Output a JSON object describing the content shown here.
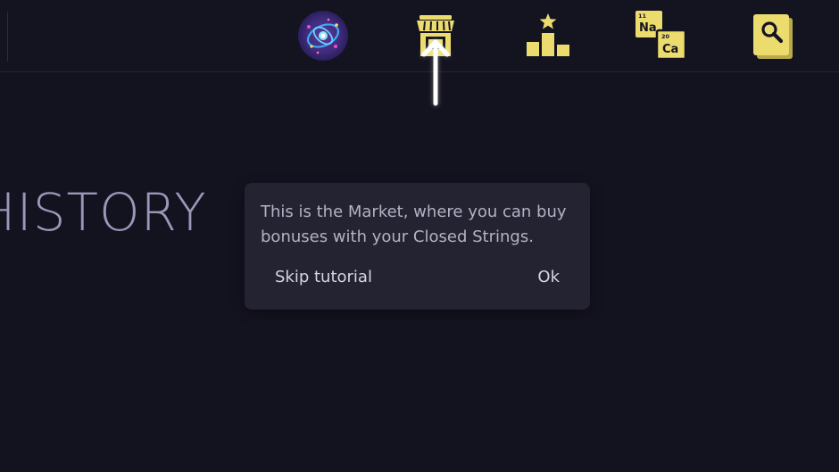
{
  "topbar": {
    "items": [
      {
        "id": "galaxy",
        "icon": "galaxy-icon"
      },
      {
        "id": "market",
        "icon": "market-stall-icon"
      },
      {
        "id": "ranking",
        "icon": "podium-star-icon"
      },
      {
        "id": "elements",
        "icon": "periodic-elements-icon",
        "symbol_a": "Na",
        "number_a": "11",
        "symbol_b": "Ca",
        "number_b": "20"
      },
      {
        "id": "search",
        "icon": "book-search-icon"
      }
    ]
  },
  "page": {
    "heading": "HISTORY"
  },
  "tutorial": {
    "message": "This is the Market, where you can buy bonuses with your Closed Strings.",
    "skip_label": "Skip tutorial",
    "ok_label": "Ok",
    "pointer_icon": "up-arrow-icon"
  },
  "colors": {
    "background": "#13121f",
    "accent_yellow": "#ecdc6e",
    "tooltip_bg": "#242332",
    "heading_color": "#9a97b8"
  }
}
